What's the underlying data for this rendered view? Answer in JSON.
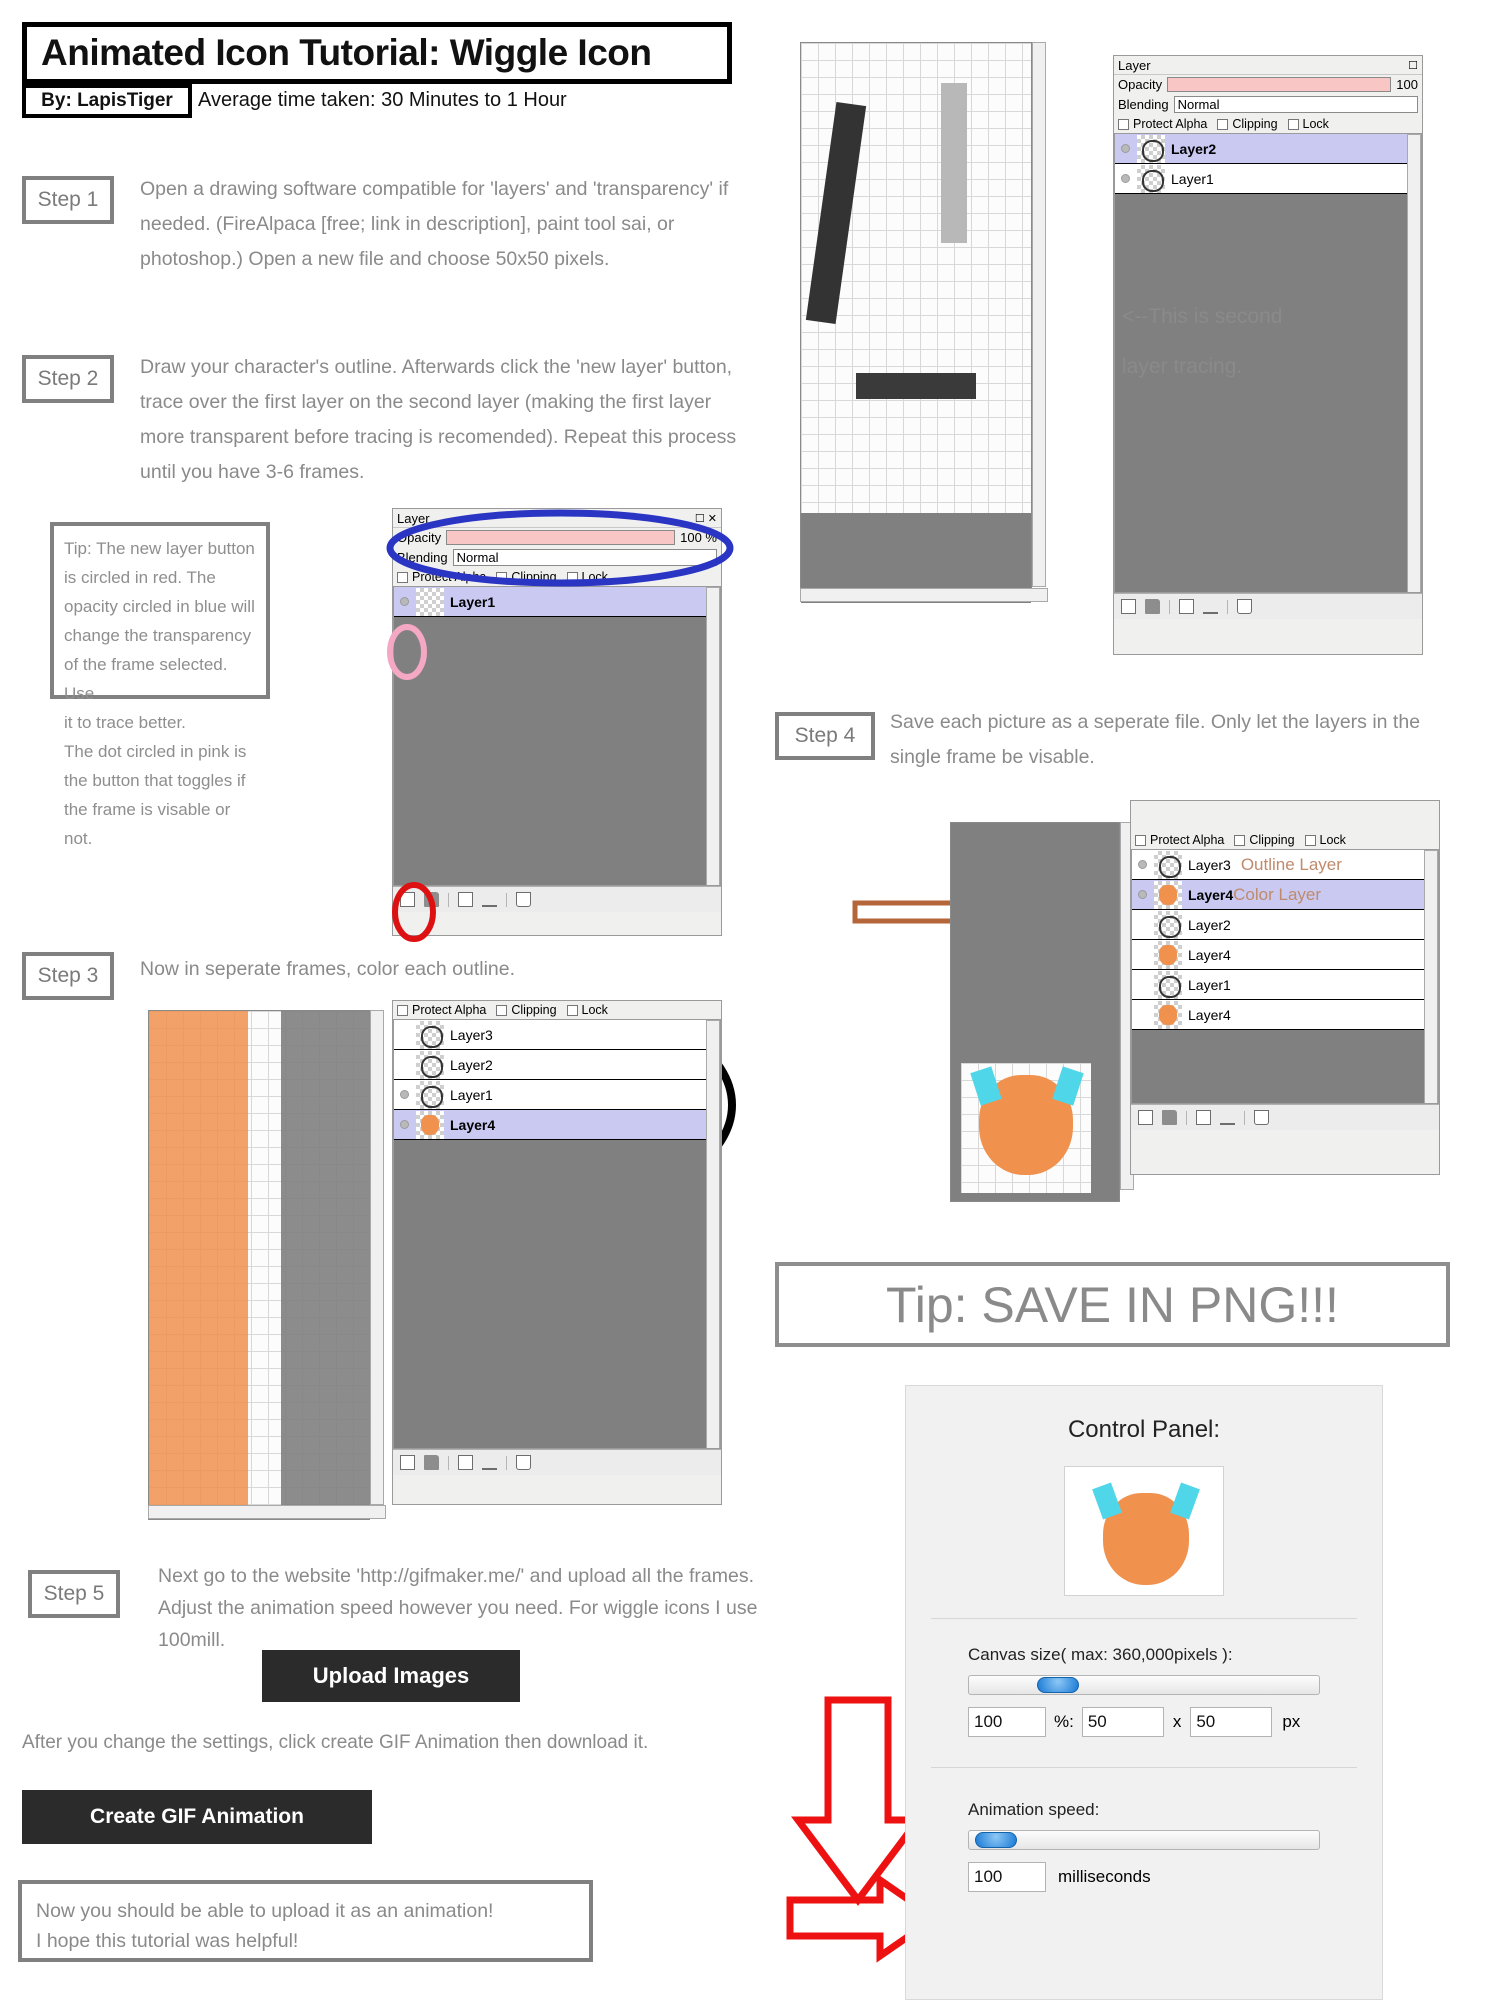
{
  "header": {
    "title": "Animated Icon Tutorial: Wiggle Icon",
    "byline": "By: LapisTiger",
    "average_time": "Average time taken: 30 Minutes to 1 Hour"
  },
  "steps": [
    {
      "label": "Step 1",
      "text": "Open a drawing software compatible for 'layers' and 'transparency' if needed. (FireAlpaca [free; link in description], paint tool sai, or photoshop.) Open a new file and choose 50x50 pixels."
    },
    {
      "label": "Step 2",
      "text": "Draw your character's outline. Afterwards click the 'new layer' button, trace over the first layer on the second layer (making the first layer more transparent before tracing is recomended). Repeat this process until you have 3-6 frames."
    },
    {
      "label": "Step 3",
      "text": "Now in seperate frames, color each outline."
    },
    {
      "label": "Step 4",
      "text": "Save each picture as a seperate file. Only let the layers in the single frame be visable."
    },
    {
      "label": "Step 5",
      "text": "Next go to the website 'http://gifmaker.me/' and upload all the frames. Adjust the animation speed however  you need. For wiggle icons I use 100mill."
    }
  ],
  "tip_box": {
    "lines": [
      "Tip: The new layer button",
      "is circled in red. The",
      "opacity circled in blue will",
      "change the transparency",
      "of the frame selected. Use",
      "it to trace better.",
      "The dot circled in pink is",
      "the button that toggles if",
      "the frame is visable or not."
    ]
  },
  "second_layer_note": {
    "line1": "<--This is second",
    "line2": "layer tracing."
  },
  "layer_panel_step2": {
    "title": "Layer",
    "opacity_label": "Opacity",
    "opacity_value": "100 %",
    "blending_label": "Blending",
    "blending_value": "Normal",
    "checks": [
      "Protect Alpha",
      "Clipping",
      "Lock"
    ],
    "layers": [
      {
        "name": "Layer1",
        "selected": true,
        "visible": true,
        "thumb": "transparent"
      }
    ]
  },
  "layer_panel_topright": {
    "title": "Layer",
    "opacity_label": "Opacity",
    "opacity_value": "100",
    "blending_label": "Blending",
    "blending_value": "Normal",
    "checks": [
      "Protect Alpha",
      "Clipping",
      "Lock"
    ],
    "layers": [
      {
        "name": "Layer2",
        "selected": true,
        "visible": true,
        "thumb": "cat"
      },
      {
        "name": "Layer1",
        "selected": false,
        "visible": true,
        "thumb": "cat"
      }
    ]
  },
  "layer_panel_step3": {
    "checks": [
      "Protect Alpha",
      "Clipping",
      "Lock"
    ],
    "layers": [
      {
        "name": "Layer3",
        "selected": false,
        "visible": false,
        "thumb": "cat"
      },
      {
        "name": "Layer2",
        "selected": false,
        "visible": false,
        "thumb": "cat"
      },
      {
        "name": "Layer1",
        "selected": false,
        "visible": true,
        "thumb": "cat"
      },
      {
        "name": "Layer4",
        "selected": true,
        "visible": true,
        "thumb": "orange"
      }
    ]
  },
  "layer_panel_step4": {
    "checks": [
      "Protect Alpha",
      "Clipping",
      "Lock"
    ],
    "annotation_outline": "Outline Layer",
    "annotation_color": "Color Layer",
    "layers": [
      {
        "name": "Layer3",
        "selected": false,
        "visible": true,
        "thumb": "cat"
      },
      {
        "name": "Layer4",
        "selected": true,
        "visible": true,
        "thumb": "orange"
      },
      {
        "name": "Layer2",
        "selected": false,
        "visible": false,
        "thumb": "cat"
      },
      {
        "name": "Layer4",
        "selected": false,
        "visible": false,
        "thumb": "orange"
      },
      {
        "name": "Layer1",
        "selected": false,
        "visible": false,
        "thumb": "cat"
      },
      {
        "name": "Layer4",
        "selected": false,
        "visible": false,
        "thumb": "orange"
      }
    ]
  },
  "png_tip": "Tip: SAVE IN PNG!!!",
  "upload_button": "Upload Images",
  "after_settings_text": "After you change the settings, click create GIF Animation then download it.",
  "create_gif_button": "Create GIF Animation",
  "closing_box": {
    "line1": "Now you should be able to upload it as an animation!",
    "line2": "I hope this tutorial was helpful!"
  },
  "control_panel": {
    "title": "Control Panel:",
    "canvas_size_label": "Canvas size( max: 360,000pixels ):",
    "canvas_percent": "100",
    "percent_symbol": "%:",
    "canvas_width": "50",
    "times_symbol": "x",
    "canvas_height": "50",
    "px_unit": "px",
    "animation_speed_label": "Animation speed:",
    "animation_speed_value": "100",
    "animation_speed_unit": "milliseconds"
  },
  "colors": {
    "accent_gray": "#8a8a8a",
    "red_circle": "#dd1111",
    "blue_circle": "#2b35c4",
    "pink_circle": "#f5a8c3",
    "orange_arrow": "#b5653a",
    "red_arrow": "#ee1111",
    "selected_layer": "#c9c9f2",
    "opacity_bar": "#f9c6c6"
  }
}
